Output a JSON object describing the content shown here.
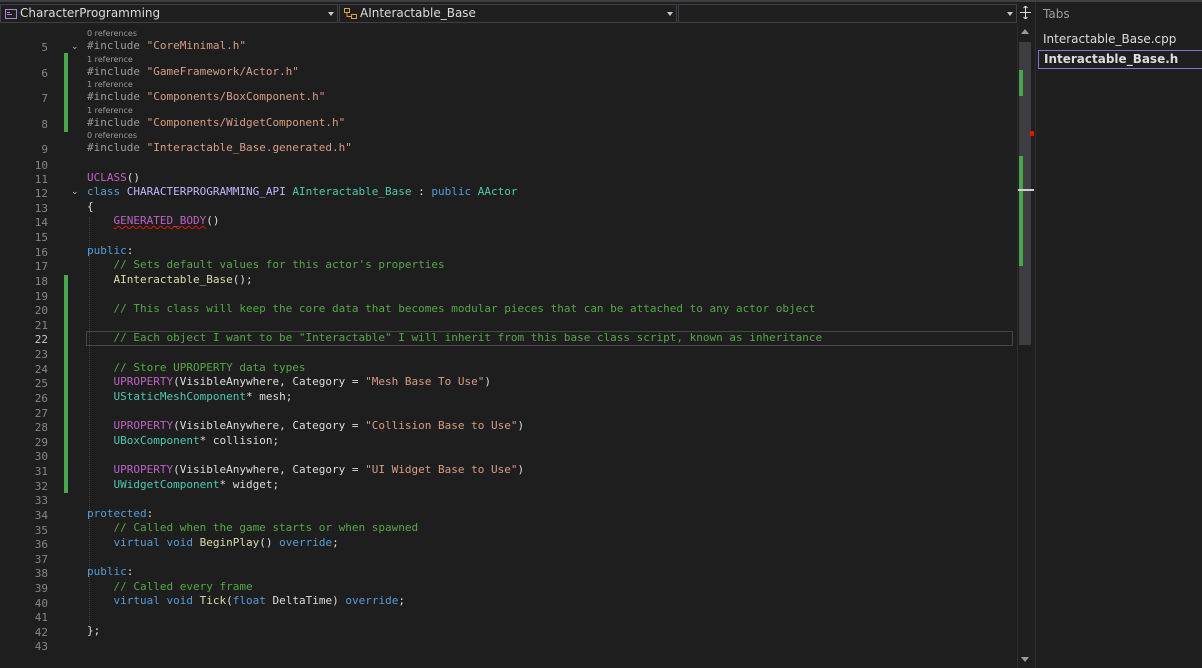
{
  "navbar": {
    "project": "CharacterProgramming",
    "class_name": "AInteractable_Base",
    "member": ""
  },
  "tabs": {
    "header": "Tabs",
    "items": [
      "Interactable_Base.cpp",
      "Interactable_Base.h"
    ],
    "active": "Interactable_Base.h"
  },
  "editor": {
    "line_numbers": [
      "5",
      "6",
      "7",
      "8",
      "9",
      "10",
      "11",
      "12",
      "13",
      "14",
      "15",
      "16",
      "17",
      "18",
      "19",
      "20",
      "21",
      "22",
      "23",
      "24",
      "25",
      "26",
      "27",
      "28",
      "29",
      "30",
      "31",
      "32",
      "33",
      "34",
      "35",
      "36",
      "37",
      "38",
      "39",
      "40",
      "41",
      "42",
      "43"
    ],
    "current_line": "22",
    "references": [
      "0 references",
      "1 reference",
      "1 reference",
      "1 reference",
      "0 references"
    ],
    "code": {
      "l5a": "#include ",
      "l5b": "\"CoreMinimal.h\"",
      "l6a": "#include ",
      "l6b": "\"GameFramework/Actor.h\"",
      "l7a": "#include ",
      "l7b": "\"Components/BoxComponent.h\"",
      "l8a": "#include ",
      "l8b": "\"Components/WidgetComponent.h\"",
      "l9a": "#include ",
      "l9b": "\"Interactable_Base.generated.h\"",
      "l11a": "UCLASS",
      "l11b": "()",
      "l12a": "class ",
      "l12b": "CHARACTERPROGRAMMING_API ",
      "l12c": "AInteractable_Base",
      "l12d": " : ",
      "l12e": "public ",
      "l12f": "AActor",
      "l13": "{",
      "l14a": "    ",
      "l14b": "GENERATED_BODY",
      "l14c": "()",
      "l16a": "public",
      "l16b": ":",
      "l17": "    // Sets default values for this actor's properties",
      "l18a": "    ",
      "l18b": "AInteractable_Base",
      "l18c": "();",
      "l20": "    // This class will keep the core data that becomes modular pieces that can be attached to any actor object",
      "l22": "    // Each object I want to be \"Interactable\" I will inherit from this base class script, known as inheritance",
      "l24": "    // Store UPROPERTY data types",
      "l25a": "    ",
      "l25b": "UPROPERTY",
      "l25c": "(VisibleAnywhere, Category = ",
      "l25d": "\"Mesh Base To Use\"",
      "l25e": ")",
      "l26a": "    ",
      "l26b": "UStaticMeshComponent",
      "l26c": "* mesh;",
      "l28a": "    ",
      "l28b": "UPROPERTY",
      "l28c": "(VisibleAnywhere, Category = ",
      "l28d": "\"Collision Base to Use\"",
      "l28e": ")",
      "l29a": "    ",
      "l29b": "UBoxComponent",
      "l29c": "* collision;",
      "l31a": "    ",
      "l31b": "UPROPERTY",
      "l31c": "(VisibleAnywhere, Category = ",
      "l31d": "\"UI Widget Base to Use\"",
      "l31e": ")",
      "l32a": "    ",
      "l32b": "UWidgetComponent",
      "l32c": "* widget;",
      "l34a": "protected",
      "l34b": ":",
      "l35": "    // Called when the game starts or when spawned",
      "l36a": "    ",
      "l36b": "virtual ",
      "l36c": "void ",
      "l36d": "BeginPlay",
      "l36e": "() ",
      "l36f": "override",
      "l36g": ";",
      "l38a": "public",
      "l38b": ":",
      "l39": "    // Called every frame",
      "l40a": "    ",
      "l40b": "virtual ",
      "l40c": "void ",
      "l40d": "Tick",
      "l40e": "(",
      "l40f": "float ",
      "l40g": "DeltaTime) ",
      "l40h": "override",
      "l40i": ";",
      "l42": "};"
    }
  },
  "icons": {
    "project": "cpp-project-icon",
    "class": "class-icon",
    "split": "split-window-icon"
  },
  "colors": {
    "keyword": "#569cd6",
    "string": "#d69d85",
    "comment": "#57a64a",
    "type": "#4ec9b0",
    "macro": "#bd63c5",
    "function": "#dcdcaa",
    "change_bar": "#4aa64a",
    "active_tab_border": "#8f6bd8"
  }
}
